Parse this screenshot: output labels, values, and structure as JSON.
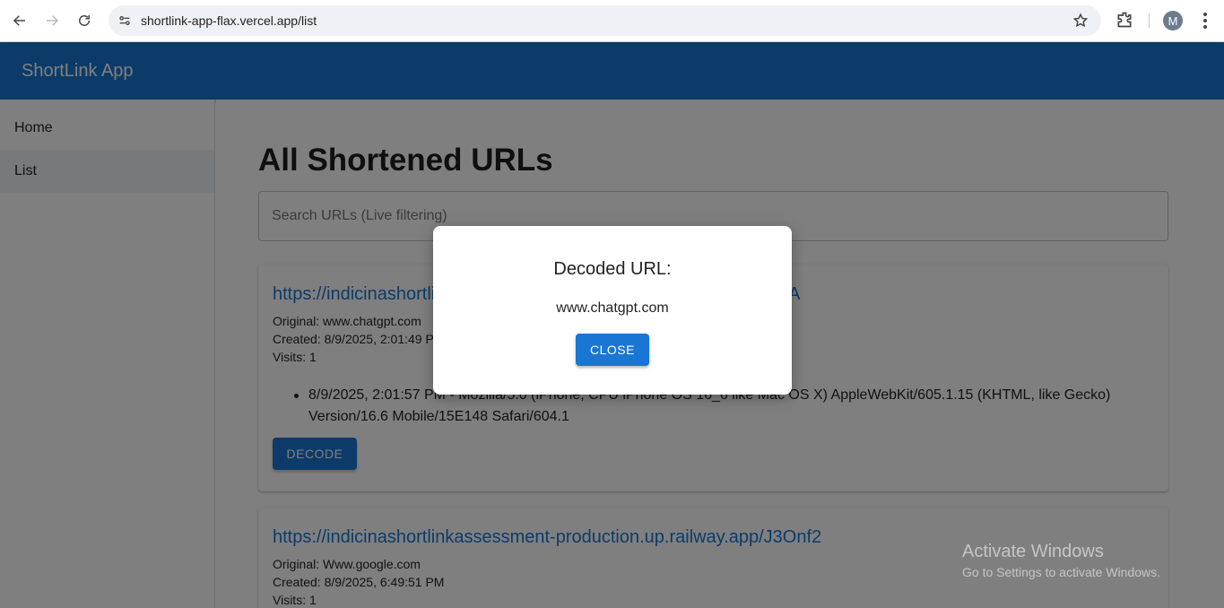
{
  "browser": {
    "url": "shortlink-app-flax.vercel.app/list",
    "profile_initial": "M"
  },
  "app": {
    "title": "ShortLink App"
  },
  "sidebar": {
    "items": [
      {
        "label": "Home"
      },
      {
        "label": "List"
      }
    ]
  },
  "main": {
    "title": "All Shortened URLs",
    "search_placeholder": "Search URLs (Live filtering)",
    "cards": [
      {
        "short_url": "https://indicinashortlinkassessment-production.up.railway.app/ViJA",
        "original": "Original: www.chatgpt.com",
        "created": "Created: 8/9/2025, 2:01:49 PM",
        "visits": "Visits: 1",
        "visit_entries": [
          "8/9/2025, 2:01:57 PM - Mozilla/5.0 (iPhone; CPU iPhone OS 16_6 like Mac OS X) AppleWebKit/605.1.15 (KHTML, like Gecko) Version/16.6 Mobile/15E148 Safari/604.1"
        ],
        "decode_label": "DECODE"
      },
      {
        "short_url": "https://indicinashortlinkassessment-production.up.railway.app/J3Onf2",
        "original": "Original: Www.google.com",
        "created": "Created: 8/9/2025, 6:49:51 PM",
        "visits": "Visits: 1"
      }
    ]
  },
  "modal": {
    "title": "Decoded URL:",
    "url": "www.chatgpt.com",
    "close_label": "CLOSE"
  },
  "watermark": {
    "title": "Activate Windows",
    "subtitle": "Go to Settings to activate Windows."
  },
  "colors": {
    "primary": "#1976d2",
    "backdrop": "rgba(0,0,0,0.5)"
  }
}
